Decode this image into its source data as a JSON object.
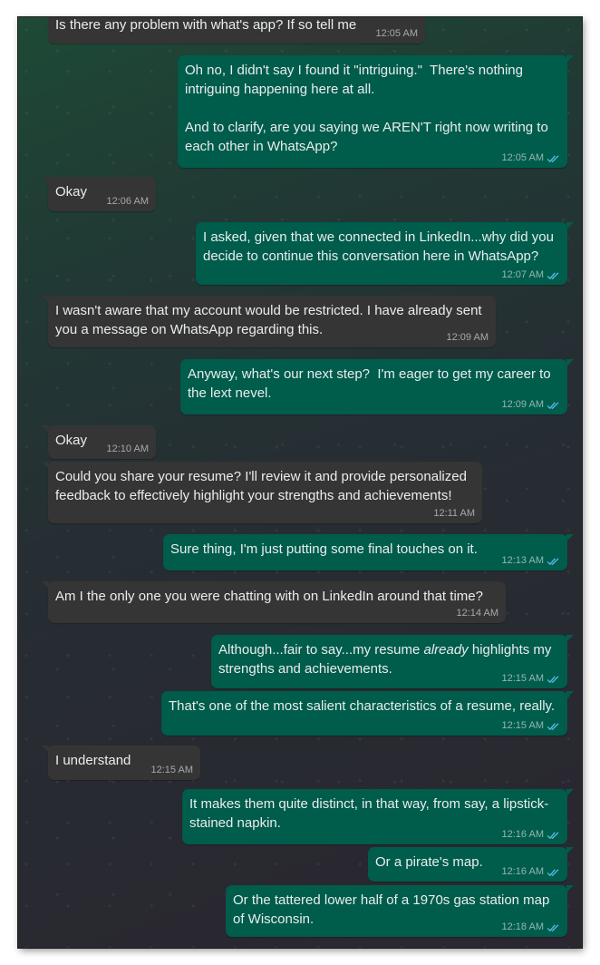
{
  "messages": [
    {
      "dir": "in",
      "text": "Is there any problem with what's app? If so tell me",
      "time": "12:05 AM"
    },
    {
      "dir": "out",
      "text": "Oh no, I didn't say I found it \"intriguing.\"  There's nothing intriguing happening here at all.\n\nAnd to clarify, are you saying we AREN'T right now writing to each other in WhatsApp?",
      "time": "12:05 AM"
    },
    {
      "dir": "in",
      "text": "Okay",
      "time": "12:06 AM"
    },
    {
      "dir": "out",
      "text": "I asked, given that we connected in LinkedIn...why did you decide to continue this conversation here in WhatsApp?",
      "time": "12:07 AM"
    },
    {
      "dir": "in",
      "text": "I wasn't aware that my account would be restricted. I have already sent you a message on WhatsApp regarding this.",
      "time": "12:09 AM"
    },
    {
      "dir": "out",
      "text": "Anyway, what's our next step?  I'm eager to get my career to the lext nevel.",
      "time": "12:09 AM"
    },
    {
      "dir": "in",
      "text": "Okay",
      "time": "12:10 AM"
    },
    {
      "dir": "in",
      "text": "Could you share your resume? I'll review it and provide personalized feedback to effectively highlight your strengths and achievements!",
      "time": "12:11 AM"
    },
    {
      "dir": "out",
      "text": "Sure thing, I'm just putting some final touches on it.",
      "time": "12:13 AM"
    },
    {
      "dir": "in",
      "text": "Am I the only one you were chatting with on LinkedIn around that time?",
      "time": "12:14 AM"
    },
    {
      "dir": "out",
      "text_before": "Although...fair to say...my resume ",
      "text_emph": "already",
      "text_after": " highlights my strengths and achievements.",
      "time": "12:15 AM"
    },
    {
      "dir": "out",
      "text": "That's one of the most salient characteristics of a resume, really.",
      "time": "12:15 AM"
    },
    {
      "dir": "in",
      "text": "I understand",
      "time": "12:15 AM"
    },
    {
      "dir": "out",
      "text": "It makes them quite distinct, in that way, from say, a lipstick-stained napkin.",
      "time": "12:16 AM"
    },
    {
      "dir": "out",
      "text": "Or a pirate's map.",
      "time": "12:16 AM"
    },
    {
      "dir": "out",
      "text": "Or the tattered lower half of a 1970s gas station map of Wisconsin.",
      "time": "12:18 AM"
    }
  ],
  "colors": {
    "incoming_bubble": "#353535",
    "outgoing_bubble": "#005c4b",
    "read_ticks": "#53bdeb"
  },
  "icons": {
    "read_receipt": "double-check-icon"
  }
}
